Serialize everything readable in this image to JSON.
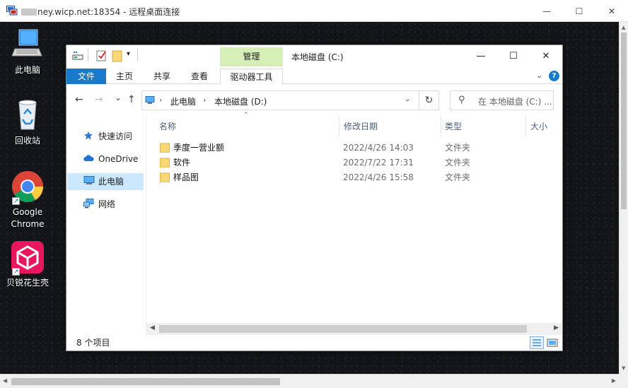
{
  "rdp": {
    "title_suffix": "ney.wicp.net:18354 - 远程桌面连接",
    "minimize": "—",
    "maximize": "☐",
    "close": "✕"
  },
  "desktop": {
    "icons": [
      {
        "label": "此电脑",
        "icon": "computer-icon"
      },
      {
        "label": "回收站",
        "icon": "recycle-bin-icon"
      },
      {
        "label": "Google\nChrome",
        "icon": "chrome-icon"
      },
      {
        "label": "贝锐花生壳",
        "icon": "oray-icon"
      }
    ]
  },
  "explorer": {
    "contextual_tab": "管理",
    "title": "本地磁盘 (C:)",
    "ribbon_tabs": [
      "文件",
      "主页",
      "共享",
      "查看",
      "驱动器工具"
    ],
    "help": "?",
    "nav": {
      "back": "←",
      "forward": "→",
      "recent": "⌄",
      "up": "↑"
    },
    "address": {
      "crumbs": [
        "此电脑",
        "本地磁盘 (D:)"
      ],
      "separator": "›"
    },
    "refresh": "↻",
    "search_placeholder": "在 本地磁盘 (C:) ...",
    "navpane": [
      {
        "label": "快速访问",
        "icon": "star-icon",
        "selected": false
      },
      {
        "label": "OneDrive",
        "icon": "cloud-icon",
        "selected": false
      },
      {
        "label": "此电脑",
        "icon": "computer-icon",
        "selected": true
      },
      {
        "label": "网络",
        "icon": "network-icon",
        "selected": false
      }
    ],
    "columns": [
      "名称",
      "修改日期",
      "类型",
      "大小"
    ],
    "files": [
      {
        "name": "季度一营业额",
        "modified": "2022/4/26 14:03",
        "type": "文件夹"
      },
      {
        "name": "软件",
        "modified": "2022/7/22 17:31",
        "type": "文件夹"
      },
      {
        "name": "样品图",
        "modified": "2022/4/26 15:58",
        "type": "文件夹"
      }
    ],
    "status_count": "8 个项目"
  },
  "colors": {
    "file_tab": "#1979ca",
    "manage_tab": "#d6efb7",
    "selected_nav": "#cce8ff",
    "folder": "#f8d775"
  }
}
